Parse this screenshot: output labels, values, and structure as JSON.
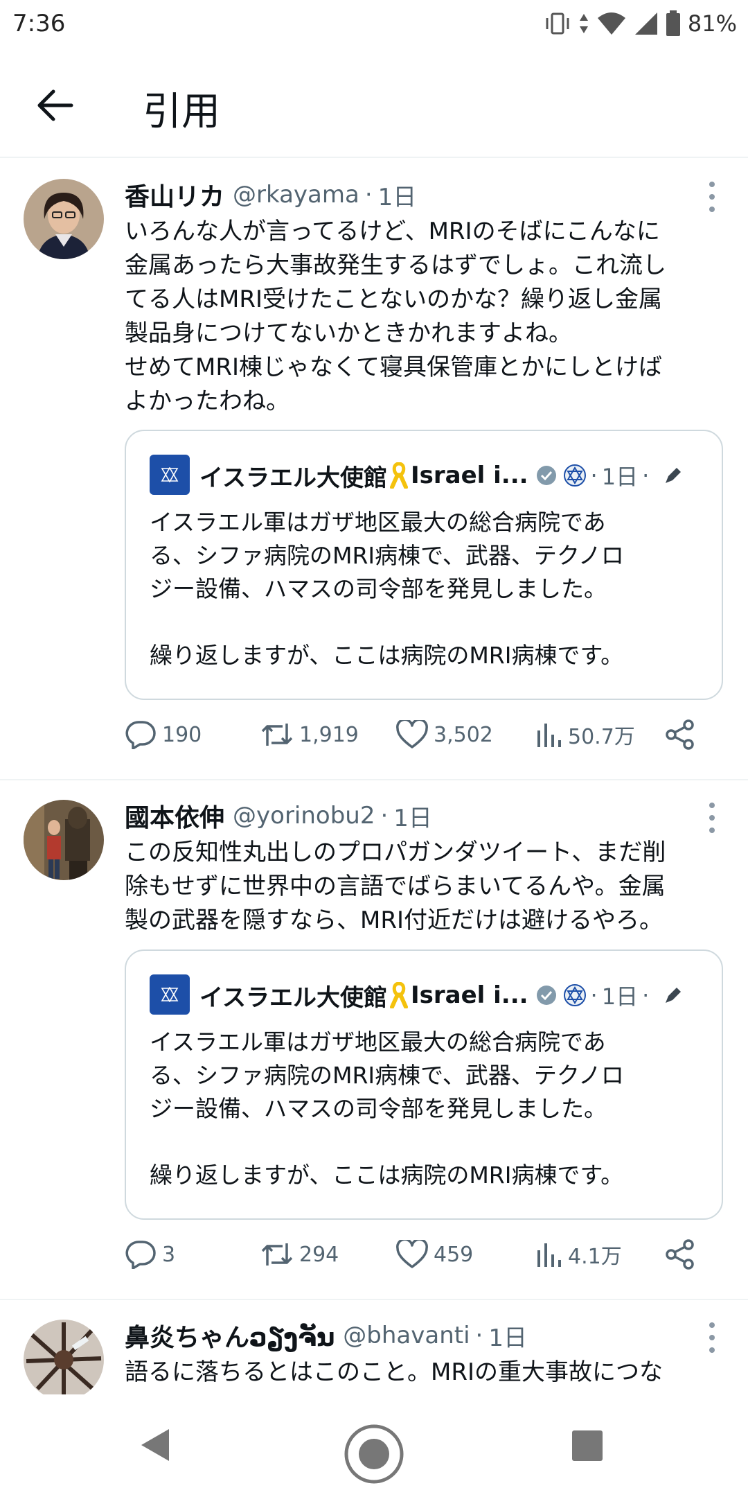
{
  "status_bar": {
    "time": "7:36",
    "battery": "81%"
  },
  "header": {
    "title": "引用",
    "back_icon": "arrow-left-icon"
  },
  "tweets": [
    {
      "display_name": "香山リカ",
      "handle": "@rkayama",
      "separator": "·",
      "time": "1日",
      "text": "いろんな人が言ってるけど、MRIのそばにこんなに\n金属あったら大事故発生するはずでしょ。これ流し\nてる人はMRI受けたことないのかな？繰り返し金属\n製品身につけてないかときかれますよね。\nせめてMRI棟じゃなくて寝具保管庫とかにしとけば\nよかったわね。",
      "quote": {
        "name": "イスラエル大使館",
        "name_en": "Israel i...",
        "separator": "·",
        "time": "1日",
        "trailing_dot": "·",
        "text": "イスラエル軍はガザ地区最大の総合病院であ\nる、シファ病院のMRI病棟で、武器、テクノロ\nジー設備、ハマスの司令部を発見しました。\n\n繰り返しますが、ここは病院のMRI病棟です。"
      },
      "replies": "190",
      "retweets": "1,919",
      "likes": "3,502",
      "views": "50.7万"
    },
    {
      "display_name": "國本依伸",
      "handle": "@yorinobu2",
      "separator": "·",
      "time": "1日",
      "text": "この反知性丸出しのプロパガンダツイート、まだ削\n除もせずに世界中の言語でばらまいてるんや。金属\n製の武器を隠すなら、MRI付近だけは避けるやろ。",
      "quote": {
        "name": "イスラエル大使館",
        "name_en": "Israel i...",
        "separator": "·",
        "time": "1日",
        "trailing_dot": "·",
        "text": "イスラエル軍はガザ地区最大の総合病院であ\nる、シファ病院のMRI病棟で、武器、テクノロ\nジー設備、ハマスの司令部を発見しました。\n\n繰り返しますが、ここは病院のMRI病棟です。"
      },
      "replies": "3",
      "retweets": "294",
      "likes": "459",
      "views": "4.1万"
    },
    {
      "display_name": "鼻炎ちゃんວຽງຈັນ",
      "handle": "@bhavanti",
      "separator": "·",
      "time": "1日",
      "text": "語るに落ちるとはこのこと。MRIの重大事故につな"
    }
  ],
  "colors": {
    "text": "#0f1419",
    "secondary": "#536471",
    "border": "#cfd9de",
    "divider": "#eff3f4",
    "verified": "#829aab"
  },
  "icons": [
    "reply-icon",
    "retweet-icon",
    "like-icon",
    "views-icon",
    "share-icon",
    "more-icon",
    "verified-badge-icon",
    "gov-flag-icon",
    "ribbon-icon",
    "edit-icon"
  ]
}
